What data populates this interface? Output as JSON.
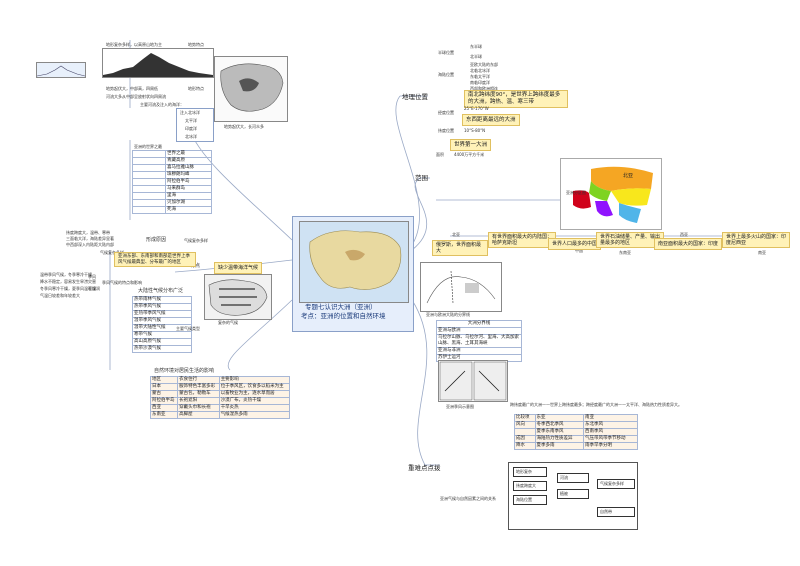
{
  "central": {
    "title": "专题七认识大洲（亚洲）",
    "subtitle": "考点：亚洲的位置和自然环境"
  },
  "branches": {
    "location": "地理位置",
    "range": "范围",
    "keypoints": "重难点点拨"
  },
  "location": {
    "rows": [
      "半球位置",
      "东半球",
      "北半球",
      "海陆位置",
      "亚欧大陆的东部",
      "北临北冰洋",
      "东临太平洋",
      "南临印度洋",
      "西部和欧洲相连"
    ],
    "highlight_lat": "南北跨纬度90°，是世界上跨纬度最多的大洲，跨热、温、寒三带",
    "lon_label": "经度位置",
    "lon_value": "东西距离最远的大洲",
    "lon_detail": "25°E-170°W",
    "lat_label": "纬度位置",
    "lat_detail": "10°S-80°N"
  },
  "range": {
    "area_label": "面积",
    "area_value": "世界第一大洲",
    "area_num": "4400万平方千米",
    "map_caption": "亚洲分区图",
    "map_regions": [
      "北亚",
      "中亚",
      "西亚",
      "东亚",
      "南亚",
      "东南亚"
    ]
  },
  "facts": [
    {
      "tag": "北亚",
      "text": "俄罗斯，世界面积最大"
    },
    {
      "tag": "东亚",
      "text": "有世界面积最大的内陆国：哈萨克斯坦"
    },
    {
      "tag": "中国",
      "text": "世界人口最多的中国"
    },
    {
      "tag": "东南亚",
      "text": "世界石油储量、产量、输出量最多的地区"
    },
    {
      "tag": "西亚",
      "text": "南亚面积最大的国家：印度"
    },
    {
      "tag": "南亚",
      "text": "世界上最多火山的国家：印度尼西亚"
    }
  ],
  "terrain": {
    "caption1": "地形特点",
    "line1": "地势起伏大，中部高，四周低",
    "line2": "河流大多从中部呈放射状向四周流",
    "line3": "主要河流及注入的海洋：",
    "label_top": "地势特点",
    "label_mid": "地形特点",
    "top_line": "地形复杂多样，以高原山地为主",
    "oceans": [
      "注入北冰洋",
      "太平洋",
      "印度洋",
      "北冰洋"
    ],
    "map_caption": "地势起伏大，长河众多",
    "profile_caption": "沿30°N纬线地形剖面"
  },
  "world_most": {
    "title": "亚洲的世界之最",
    "items": [
      "世界之最",
      "青藏高原",
      "喜马拉雅山脉",
      "珠穆朗玛峰",
      "阿拉伯半岛",
      "马来群岛",
      "里海",
      "贝加尔湖",
      "死海"
    ]
  },
  "climate": {
    "title": "形成原因",
    "r1": "纬度跨度大，温带、寒带",
    "r2": "三面临大洋，海陆差异显著",
    "r3": "中西部深入内陆距大陆内部",
    "complex": "气候复杂多样",
    "complex_label": "特点",
    "monsoon": "亚洲东部、东南部和南部是世界上季风气候最典型、分布最广的地区",
    "monsoon_box": "缺少温带海洋气候",
    "map_caption": "复杂的气候",
    "types_title": "大陆性气候分布广泛",
    "types": [
      "热带雨林气候",
      "热带季风气候",
      "亚热带季风气候",
      "温带季风气候",
      "温带大陆性气候",
      "寒带气候",
      "高山高原气候",
      "热带沙漠气候"
    ],
    "types_label": "主要气候类型",
    "n1": "温带季风气候，冬季寒冷干燥",
    "n2": "降水不稳定，容易发生旱涝灾害",
    "n3": "冬季风寒冷干燥，夏季风温暖湿润",
    "n4": "气温日较差和年较差大",
    "c1": "季风气候的特点和影响",
    "c2": "季风",
    "c3": "干燥"
  },
  "water": {
    "map_caption": "亚洲与欧洲大陆的分界线",
    "rows": [
      "大洲分界线",
      "亚洲与欧洲",
      "乌拉尔山脉、乌拉尔河、里海、大高加索山脉、黑海、土耳其海峡",
      "亚洲与非洲",
      "苏伊士运河"
    ]
  },
  "lifestyle": {
    "title": "自然环境对居民生活的影响",
    "rows": [
      [
        "地区",
        "衣食住行",
        "主要影响"
      ],
      [
        "日本",
        "服饰特色丰富多彩",
        "位于季风区，饮食多以稻米为主"
      ],
      [
        "蒙古",
        "蒙古包，勒勒车",
        "以畜牧业为主，逐水草而居"
      ],
      [
        "阿拉伯半岛",
        "长袍遮阳",
        "沙漠广布，炎热干燥"
      ],
      [
        "西亚",
        "穿戴头巾和长袍",
        "干旱炎热"
      ],
      [
        "东南亚",
        "高脚屋",
        "气候湿热多雨"
      ]
    ]
  },
  "keypoints": {
    "line": "跨纬度最广的大洲——世界上跨纬度最多；跨经度最广的大洲——太平洋、海陆热力性质差异大。",
    "maps_caption": "亚洲季风示意图",
    "table": [
      [
        "比较项",
        "东亚",
        "南亚"
      ],
      [
        "风向",
        "冬季西北季风",
        "东北季风"
      ],
      [
        "",
        "夏季东南季风",
        "西南季风"
      ],
      [
        "成因",
        "海陆热力性质差异",
        "气压带风带季节移动"
      ],
      [
        "降水",
        "夏季多雨",
        "雨季旱季分明"
      ]
    ],
    "flow_title": "亚洲气候与自然因素之间的关系",
    "flow": [
      "地形复杂",
      "纬度跨度大",
      "海陆位置",
      "河流",
      "植被",
      "气候复杂多样",
      "自然带"
    ]
  }
}
